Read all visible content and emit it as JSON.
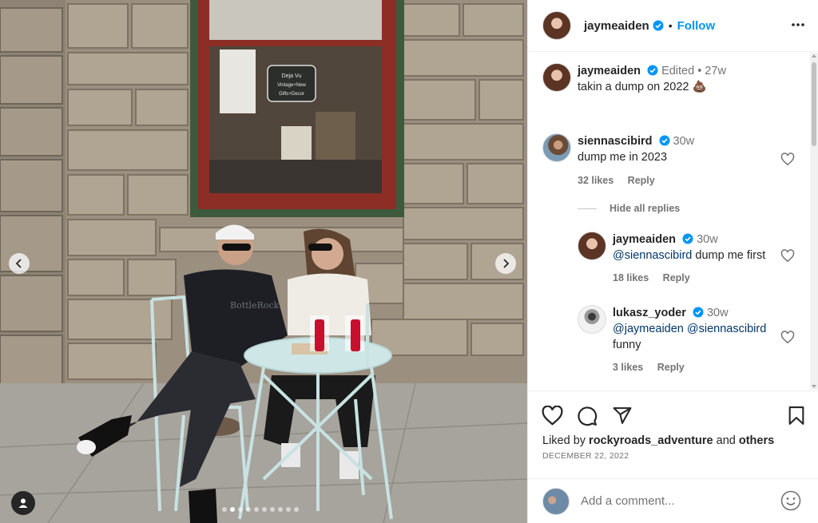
{
  "post": {
    "author": "jaymeaiden",
    "follow_label": "Follow",
    "separator": "•",
    "caption_text": "takin a dump on 2022 💩",
    "caption_meta": "Edited • 27w",
    "liked_by_prefix": "Liked by",
    "liked_by_user": "rockyroads_adventure",
    "liked_by_and": "and",
    "liked_by_others": "others",
    "date": "DECEMBER 22, 2022",
    "carousel": {
      "total_slides": 10,
      "active_index": 1
    }
  },
  "photo": {
    "window_sign": "Deja Vu Vintage + New Gifts+ Decor",
    "sweatshirt_text": "BottleRock",
    "window_reflection": "nomeluo"
  },
  "comments": [
    {
      "user": "siennascibird",
      "meta": "30w",
      "text": "dump me in 2023",
      "likes": "32 likes",
      "reply": "Reply"
    },
    {
      "user": "jaymeaiden",
      "meta": "30w",
      "mention": "@siennascibird",
      "text": "dump me first",
      "likes": "18 likes",
      "reply": "Reply"
    },
    {
      "user": "lukasz_yoder",
      "meta": "30w",
      "mention1": "@jaymeaiden",
      "mention2": "@siennascibird",
      "text": "funny",
      "likes": "3 likes",
      "reply": "Reply"
    }
  ],
  "hide_replies": "Hide all replies",
  "add_comment": {
    "placeholder": "Add a comment..."
  },
  "icons": [
    "verified-badge-icon",
    "more-options-icon",
    "heart-icon",
    "comment-icon",
    "share-icon",
    "bookmark-icon",
    "emoji-icon",
    "user-tag-icon",
    "chevron-left-icon",
    "chevron-right-icon"
  ],
  "colors": {
    "link_blue": "#0095f6",
    "verified_blue": "#0095f6",
    "muted": "#737373",
    "text": "#262626",
    "mention": "#00376b"
  }
}
